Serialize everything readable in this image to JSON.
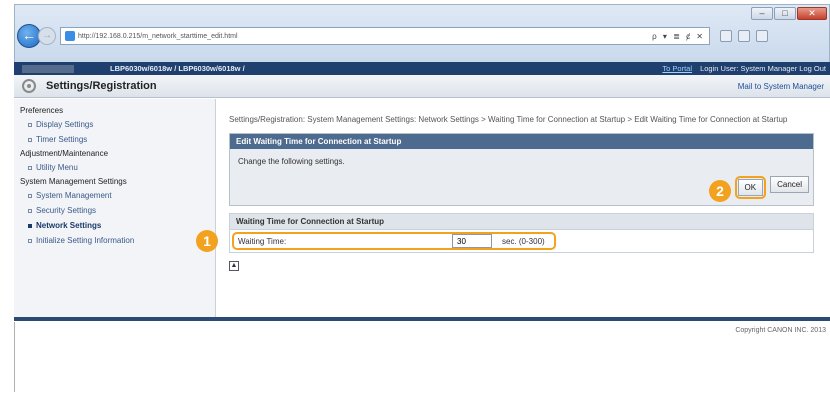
{
  "browser": {
    "url": "http://192.168.0.215/m_network_starttime_edit.html",
    "back_glyph": "←",
    "forward_glyph": "→",
    "address_icons": "ρ ▾ ≣ ȼ ✕",
    "window_buttons": [
      "–",
      "□",
      "✕"
    ]
  },
  "header": {
    "model": "LBP6030w/6018w / LBP6030w/6018w /",
    "portal_link": "To Portal",
    "login_text": "Login User: System Manager Log Out",
    "page_title": "Settings/Registration",
    "mail_link": "Mail to System Manager"
  },
  "sidebar": {
    "sections": [
      {
        "title": "Preferences",
        "items": [
          {
            "label": "Display Settings",
            "active": false
          },
          {
            "label": "Timer Settings",
            "active": false
          }
        ]
      },
      {
        "title": "Adjustment/Maintenance",
        "items": [
          {
            "label": "Utility Menu",
            "active": false
          }
        ]
      },
      {
        "title": "System Management Settings",
        "items": [
          {
            "label": "System Management",
            "active": false
          },
          {
            "label": "Security Settings",
            "active": false
          },
          {
            "label": "Network Settings",
            "active": true
          },
          {
            "label": "Initialize Setting Information",
            "active": false
          }
        ]
      }
    ]
  },
  "main": {
    "breadcrumb": "Settings/Registration: System Management Settings: Network Settings > Waiting Time for Connection at Startup > Edit Waiting Time for Connection at Startup",
    "panel_title": "Edit Waiting Time for Connection at Startup",
    "instruction": "Change the following settings.",
    "ok_label": "OK",
    "cancel_label": "Cancel",
    "section_title": "Waiting Time for Connection at Startup",
    "field_label": "Waiting Time:",
    "field_value": "30",
    "field_unit": "sec. (0-300)",
    "marker_1": "1",
    "marker_2": "2",
    "top_icon": "▲"
  },
  "footer": {
    "copyright": "Copyright CANON INC. 2013"
  },
  "colors": {
    "accent_orange": "#f2a21e",
    "header_navy": "#1f3f6e",
    "panel_header": "#4d6a8f"
  }
}
